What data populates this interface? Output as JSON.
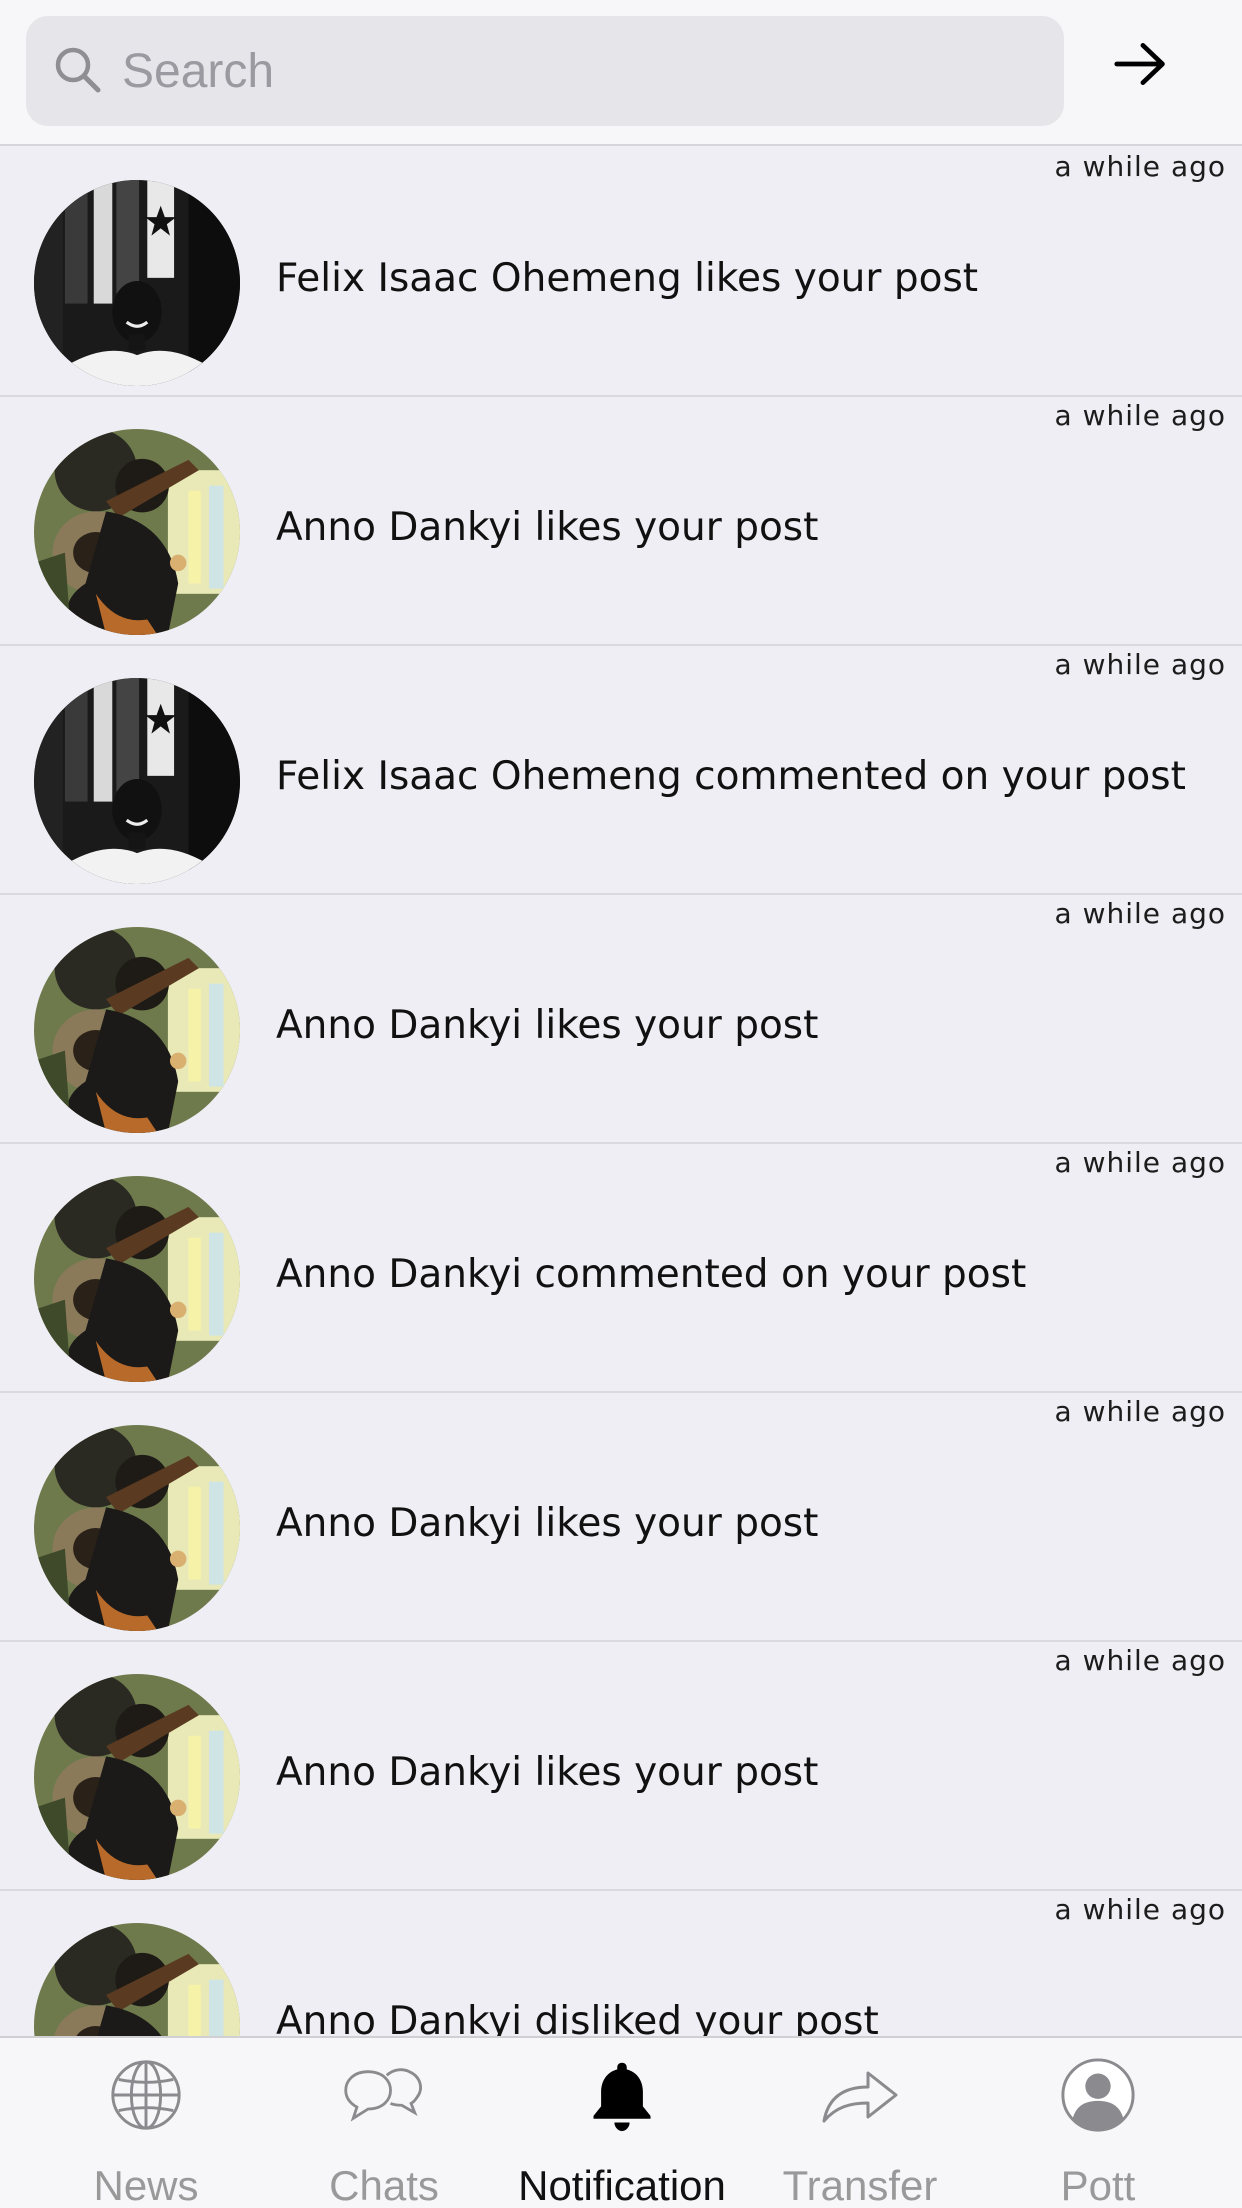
{
  "search": {
    "placeholder": "Search",
    "icon": "search-icon"
  },
  "header": {
    "forward_icon": "arrow-right-icon"
  },
  "notifications": [
    {
      "time": "a while ago",
      "text": "Felix Isaac Ohemeng likes your post",
      "avatar": "felix"
    },
    {
      "time": "a while ago",
      "text": "Anno Dankyi likes your post",
      "avatar": "anno"
    },
    {
      "time": "a while ago",
      "text": "Felix Isaac Ohemeng commented on your post",
      "avatar": "felix"
    },
    {
      "time": "a while ago",
      "text": "Anno Dankyi likes your post",
      "avatar": "anno"
    },
    {
      "time": "a while ago",
      "text": "Anno Dankyi commented on your post",
      "avatar": "anno"
    },
    {
      "time": "a while ago",
      "text": "Anno Dankyi likes your post",
      "avatar": "anno"
    },
    {
      "time": "a while ago",
      "text": "Anno Dankyi likes your post",
      "avatar": "anno"
    },
    {
      "time": "a while ago",
      "text": "Anno Dankyi disliked your post",
      "avatar": "anno"
    }
  ],
  "tabs": [
    {
      "label": "News",
      "icon": "globe-icon",
      "active": false
    },
    {
      "label": "Chats",
      "icon": "chat-bubbles-icon",
      "active": false
    },
    {
      "label": "Notification",
      "icon": "bell-icon",
      "active": true
    },
    {
      "label": "Transfer",
      "icon": "share-arrow-icon",
      "active": false
    },
    {
      "label": "Pott",
      "icon": "profile-icon",
      "active": false
    }
  ],
  "colors": {
    "background": "#efeef4",
    "bar": "#f7f7f9",
    "inactive": "#999999",
    "active": "#111111"
  }
}
